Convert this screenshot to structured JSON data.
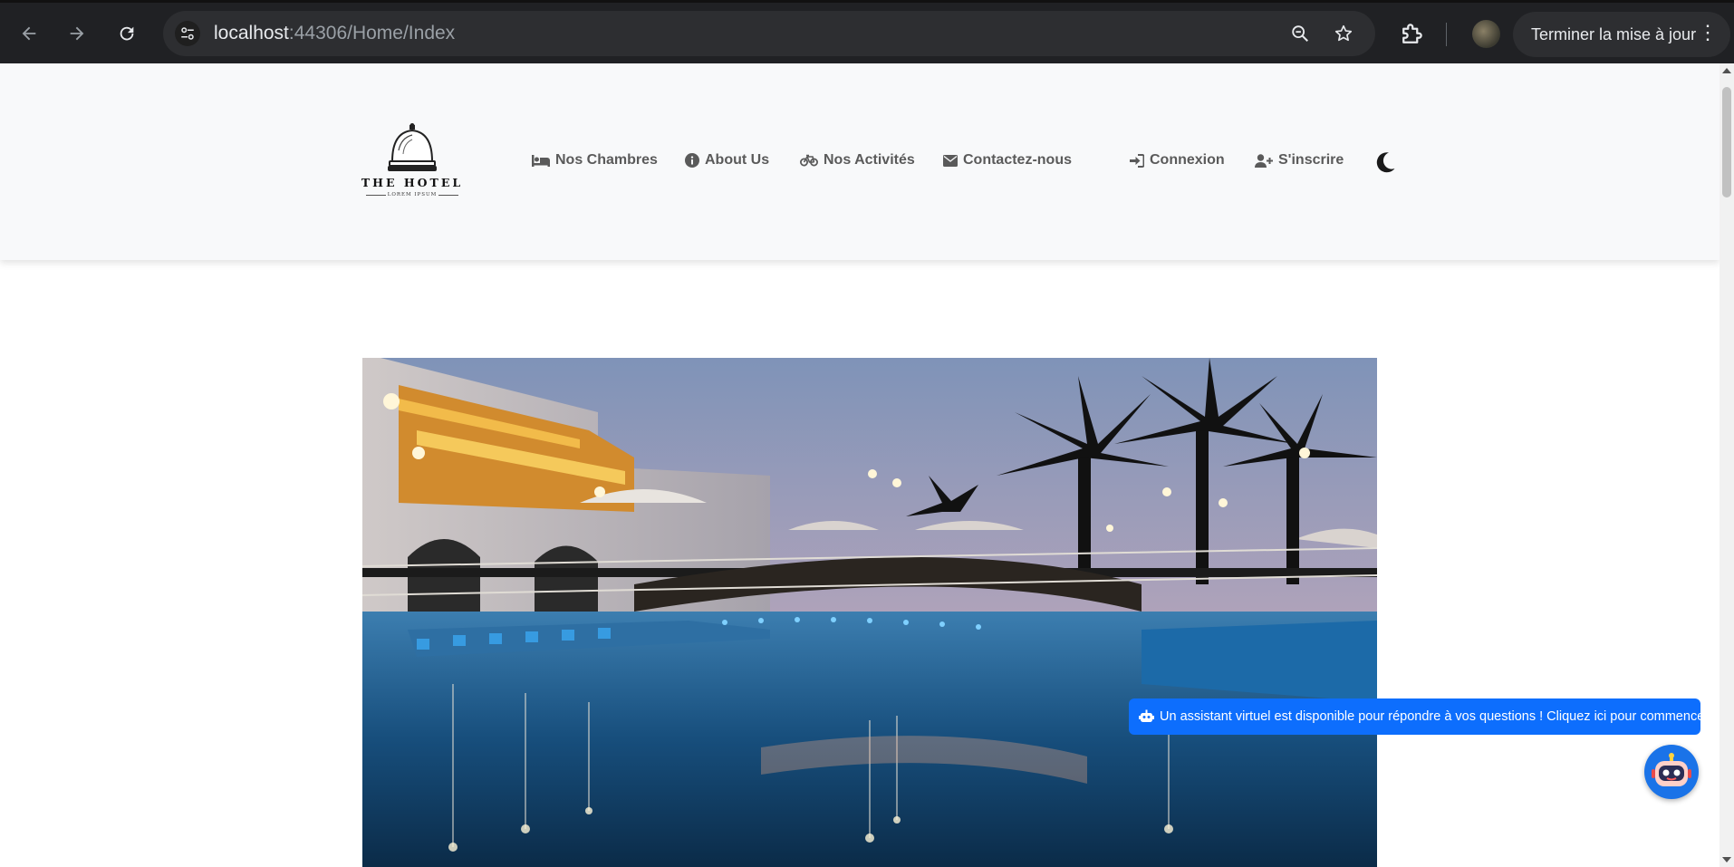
{
  "browser": {
    "url_host": "localhost",
    "url_path": ":44306/Home/Index",
    "update_button_label": "Terminer la mise à jour"
  },
  "site": {
    "logo": {
      "title": "THE HOTEL",
      "subtitle": "LOREM IPSUM"
    },
    "nav": [
      {
        "label": "Nos Chambres",
        "icon": "bed-icon"
      },
      {
        "label": "About Us",
        "icon": "info-circle-icon"
      },
      {
        "label": "Nos Activités",
        "icon": "bicycle-icon"
      },
      {
        "label": "Contactez-nous",
        "icon": "envelope-icon"
      }
    ],
    "auth": [
      {
        "label": "Connexion",
        "icon": "sign-in-icon"
      },
      {
        "label": "S'inscrire",
        "icon": "user-plus-icon"
      }
    ],
    "theme_toggle_icon": "moon-icon"
  },
  "hero": {
    "image": "hotel-pool-at-dusk-photo"
  },
  "assistant": {
    "banner_text": "Un assistant virtuel est disponible pour répondre à vos questions ! Cliquez ici pour commencer.",
    "button_icon": "robot-icon"
  },
  "colors": {
    "chrome_bg": "#202124",
    "omnibox_bg": "#2d2e31",
    "header_bg": "#f8f9fa",
    "nav_text": "#5a5a5a",
    "primary": "#0d6efd"
  }
}
